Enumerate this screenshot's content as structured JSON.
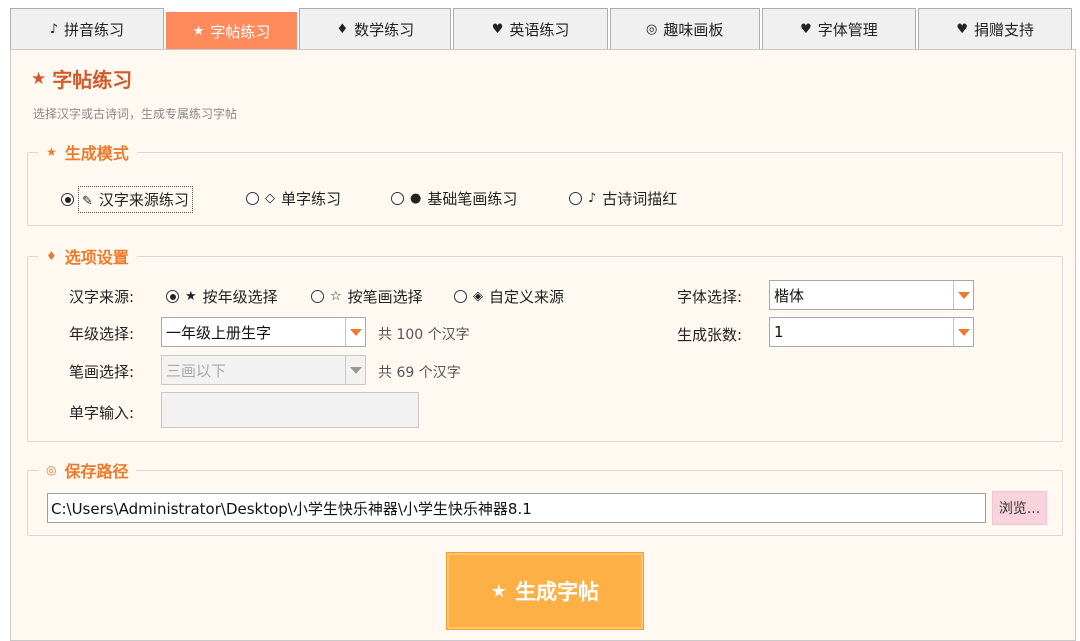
{
  "tabs": [
    {
      "icon": "♪",
      "label": "拼音练习",
      "active": false
    },
    {
      "icon": "★",
      "label": "字帖练习",
      "active": true
    },
    {
      "icon": "♦",
      "label": "数学练习",
      "active": false
    },
    {
      "icon": "♥",
      "label": "英语练习",
      "active": false
    },
    {
      "icon": "◎",
      "label": "趣味画板",
      "active": false
    },
    {
      "icon": "♥",
      "label": "字体管理",
      "active": false
    },
    {
      "icon": "♥",
      "label": "捐赠支持",
      "active": false
    }
  ],
  "page": {
    "icon": "★",
    "title": "字帖练习",
    "subtitle": "选择汉字或古诗词，生成专属练习字帖"
  },
  "mode": {
    "legend_icon": "★",
    "legend": "生成模式",
    "options": [
      {
        "icon": "✎",
        "label": "汉字来源练习",
        "selected": true
      },
      {
        "icon": "◇",
        "label": "单字练习",
        "selected": false
      },
      {
        "icon": "●",
        "label": "基础笔画练习",
        "selected": false
      },
      {
        "icon": "♪",
        "label": "古诗词描红",
        "selected": false
      }
    ]
  },
  "options": {
    "legend_icon": "♦",
    "legend": "选项设置",
    "source_label": "汉字来源:",
    "source_options": [
      {
        "icon": "★",
        "label": "按年级选择",
        "selected": true
      },
      {
        "icon": "☆",
        "label": "按笔画选择",
        "selected": false
      },
      {
        "icon": "◈",
        "label": "自定义来源",
        "selected": false
      }
    ],
    "grade_label": "年级选择:",
    "grade_value": "一年级上册生字",
    "grade_count": "共 100 个汉字",
    "stroke_label": "笔画选择:",
    "stroke_value": "三画以下",
    "stroke_count": "共 69 个汉字",
    "char_input_label": "单字输入:",
    "char_input_value": "",
    "font_label": "字体选择:",
    "font_value": "楷体",
    "sheets_label": "生成张数:",
    "sheets_value": "1"
  },
  "save": {
    "legend_icon": "◎",
    "legend": "保存路径",
    "path": "C:\\Users\\Administrator\\Desktop\\小学生快乐神器\\小学生快乐神器8.1",
    "browse_label": "浏览..."
  },
  "generate": {
    "icon": "★",
    "label": "生成字帖"
  },
  "colors": {
    "accent": "#ff8a5c",
    "title": "#d2592a",
    "legend": "#ee7a2a",
    "button": "#fcb045",
    "browse": "#f8d2dd",
    "panel_bg": "#fff9f2"
  }
}
